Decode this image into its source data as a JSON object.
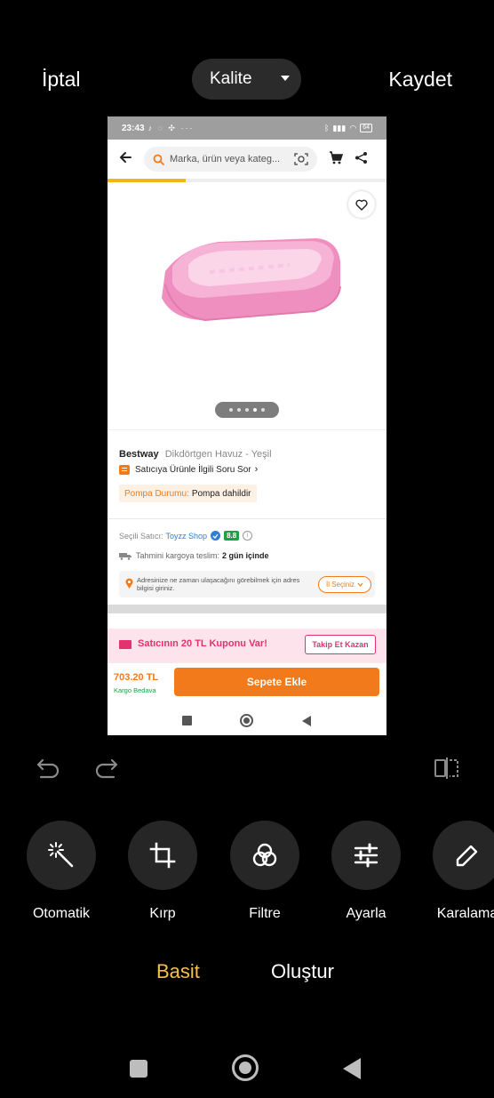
{
  "editor": {
    "cancel_label": "İptal",
    "quality_label": "Kalite",
    "save_label": "Kaydet",
    "tools": [
      {
        "label": "Otomatik",
        "icon": "magic-wand-icon"
      },
      {
        "label": "Kırp",
        "icon": "crop-icon"
      },
      {
        "label": "Filtre",
        "icon": "filter-icon"
      },
      {
        "label": "Ayarla",
        "icon": "sliders-icon"
      },
      {
        "label": "Karalama",
        "icon": "pen-icon"
      }
    ],
    "modes": {
      "basic": "Basit",
      "create": "Oluştur"
    },
    "accent_color": "#f5c144"
  },
  "screenshot": {
    "status_bar": {
      "time": "23:43",
      "battery": "64"
    },
    "search_placeholder": "Marka, ürün veya kateg...",
    "image_progress": 0.28,
    "gallery": {
      "total_images": 5,
      "active_index": 3
    },
    "product": {
      "brand": "Bestway",
      "name": "Dikdörtgen Havuz - Yeşil",
      "ask_seller": "Satıcıya Ürünle İlgili Soru Sor",
      "badge_key": "Pompa Durumu:",
      "badge_value": "Pompa dahildir"
    },
    "seller": {
      "label": "Seçili Satıcı:",
      "name": "Toyzz Shop",
      "score": "8.8",
      "delivery_label": "Tahmini kargoya teslim:",
      "delivery_value": "2 gün içinde",
      "address_text": "Adresinize ne zaman ulaşacağını görebilmek için adres bilgisi giriniz.",
      "city_button": "İl Seçiniz"
    },
    "coupon": {
      "text": "Satıcının 20 TL Kuponu Var!",
      "button": "Takip Et Kazan"
    },
    "buy": {
      "price": "703.20 TL",
      "shipping": "Kargo Bedava",
      "add_to_cart": "Sepete Ekle"
    },
    "colors": {
      "brand_orange": "#f27a1a",
      "coupon_pink": "#e3326f",
      "score_green": "#1fa045"
    }
  }
}
